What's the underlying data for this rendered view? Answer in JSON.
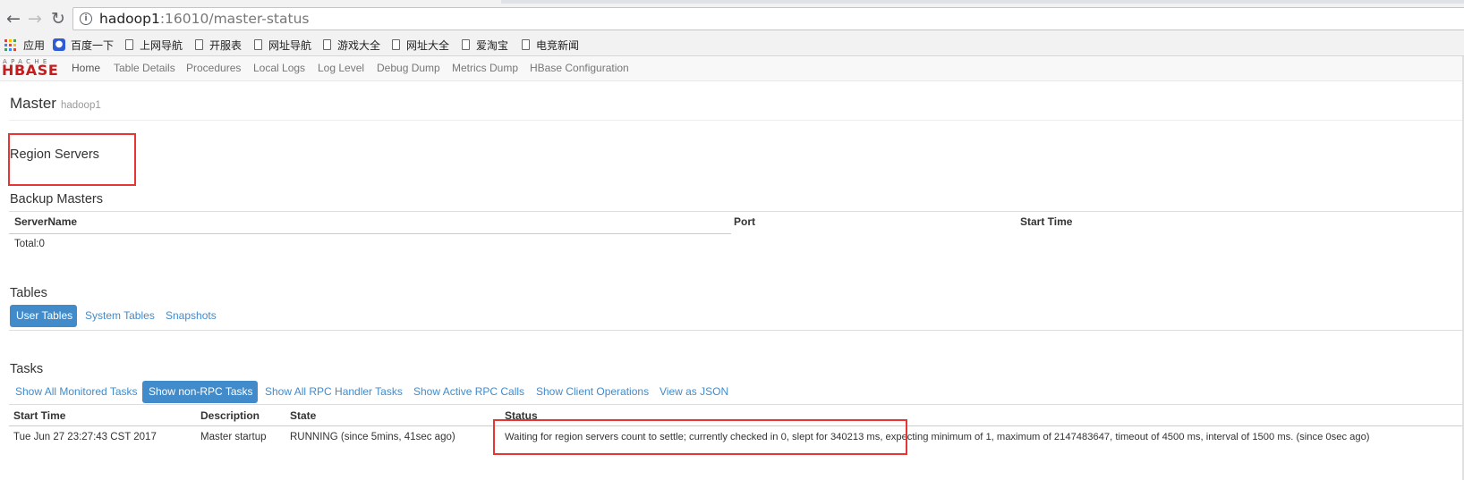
{
  "browser": {
    "url_host": "hadoop1",
    "url_rest": ":16010/master-status",
    "icons": {
      "back": "arrow-left-icon",
      "forward": "arrow-right-icon",
      "reload": "reload-icon",
      "info": "info-icon"
    },
    "bookmarks": [
      "应用",
      "百度一下",
      "上网导航",
      "开服表",
      "网址导航",
      "游戏大全",
      "网址大全",
      "爱淘宝",
      "电竞新闻"
    ]
  },
  "navbar": {
    "logo_top": "APACHE",
    "logo_main": "HBASE",
    "items": [
      "Home",
      "Table Details",
      "Procedures",
      "Local Logs",
      "Log Level",
      "Debug Dump",
      "Metrics Dump",
      "HBase Configuration"
    ]
  },
  "master": {
    "title": "Master",
    "host": "hadoop1"
  },
  "region_servers": {
    "heading": "Region Servers"
  },
  "backup_masters": {
    "heading": "Backup Masters",
    "columns": [
      "ServerName",
      "Port",
      "Start Time"
    ],
    "total": "Total:0"
  },
  "tables": {
    "heading": "Tables",
    "tabs": [
      "User Tables",
      "System Tables",
      "Snapshots"
    ]
  },
  "tasks": {
    "heading": "Tasks",
    "tabs": [
      "Show All Monitored Tasks",
      "Show non-RPC Tasks",
      "Show All RPC Handler Tasks",
      "Show Active RPC Calls",
      "Show Client Operations",
      "View as JSON"
    ],
    "columns": [
      "Start Time",
      "Description",
      "State",
      "Status"
    ],
    "rows": [
      {
        "start_time": "Tue Jun 27 23:27:43 CST 2017",
        "description": "Master startup",
        "state": "RUNNING (since 5mins, 41sec ago)",
        "status": "Waiting for region servers count to settle; currently checked in 0, slept for 340213 ms, expecting minimum of 1, maximum of 2147483647, timeout of 4500 ms, interval of 1500 ms. (since 0sec ago)"
      }
    ]
  },
  "colors": {
    "accent": "#428bca",
    "annotation": "#e53535",
    "logo": "#c51d1d"
  }
}
